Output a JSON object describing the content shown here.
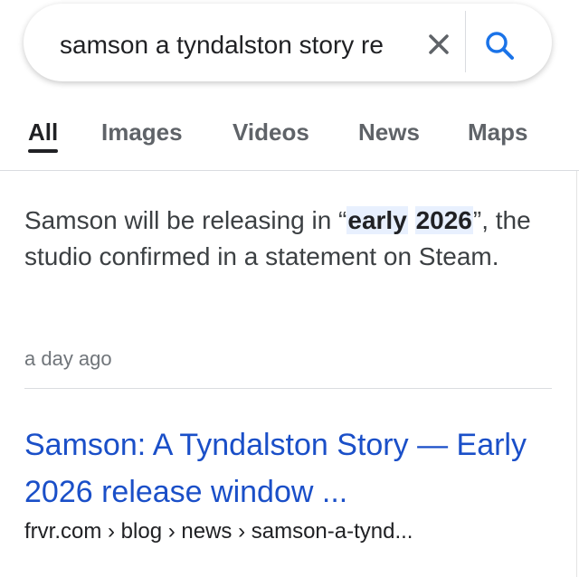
{
  "search": {
    "query": "samson a tyndalston story re",
    "clear_icon": "close-icon",
    "search_icon": "magnifier-icon",
    "accent_color": "#1a73e8"
  },
  "tabs": [
    {
      "label": "All",
      "active": true
    },
    {
      "label": "Images",
      "active": false
    },
    {
      "label": "Videos",
      "active": false
    },
    {
      "label": "News",
      "active": false
    },
    {
      "label": "Maps",
      "active": false
    }
  ],
  "snippet": {
    "part1": "Samson will be releasing in “",
    "highlight1": "early",
    "highlight2": "2026",
    "part2": "”, the studio confirmed in a statement on Steam.",
    "date": "a day ago"
  },
  "result": {
    "title": "Samson: A Tyndalston Story — Early 2026 release window ...",
    "url": "frvr.com › blog › news › samson-a-tynd..."
  }
}
